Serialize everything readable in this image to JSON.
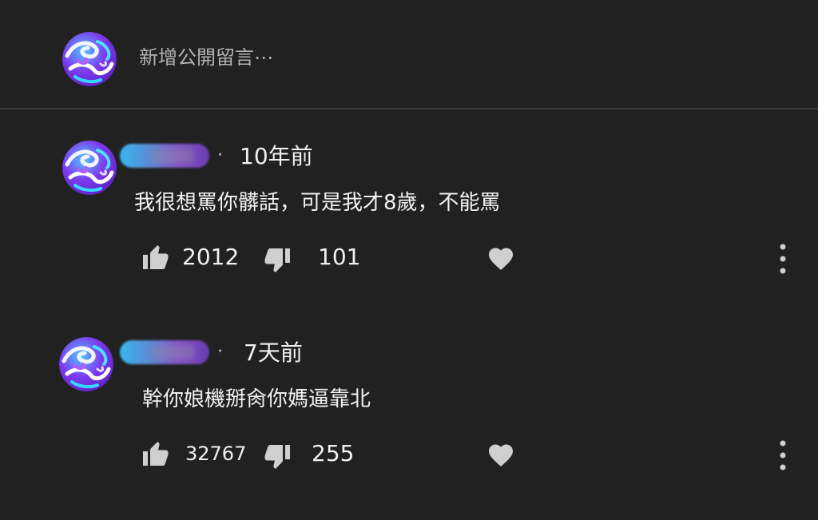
{
  "add_comment": {
    "placeholder": "新增公開留言⋯"
  },
  "comments": [
    {
      "timestamp": "10年前",
      "text": "我很想罵你髒話，可是我才8歲，不能罵",
      "likes": "2012",
      "dislikes": "101"
    },
    {
      "timestamp": "7天前",
      "text": "幹你娘機掰肏你媽逼靠北",
      "likes": "32767",
      "dislikes": "255"
    }
  ],
  "icons": {
    "like": "thumb-up-icon",
    "dislike": "thumb-down-icon",
    "heart": "heart-icon",
    "more": "more-vert-icon"
  },
  "colors": {
    "background": "#212121",
    "text": "#f1f1f1",
    "muted": "#b3b3b3",
    "icon": "#cfcfcf"
  }
}
